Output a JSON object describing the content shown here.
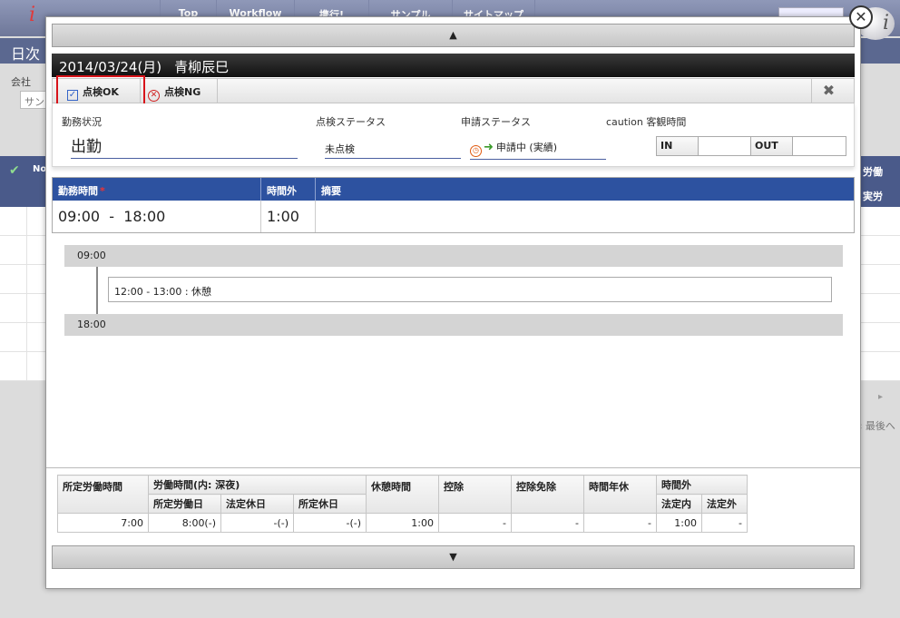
{
  "background": {
    "nav": [
      "Top",
      "Workflow",
      "携行!",
      "サンプル",
      "サイトマップ"
    ],
    "page_title": "日次",
    "company_label": "会社",
    "company_value": "サン",
    "table_no": "No",
    "right_col_1": "労働",
    "right_col_2": "実労",
    "last_link": "最後へ"
  },
  "modal": {
    "scroll_up": "▲",
    "scroll_down": "▼",
    "date": "2014/03/24(月)",
    "person": "青柳辰巳",
    "toolbar": {
      "ok_label": "点検OK",
      "ng_label": "点検NG",
      "close_icon": "✖"
    },
    "status": {
      "work_label": "勤務状況",
      "work_value": "出勤",
      "check_label": "点検ステータス",
      "check_value": "未点検",
      "app_label": "申請ステータス",
      "app_value": "申請中 (実績)",
      "caution_label": "caution 客観時間",
      "in_label": "IN",
      "out_label": "OUT"
    },
    "work_table": {
      "headers": [
        "勤務時間",
        "時間外",
        "摘要"
      ],
      "time_from": "09:00",
      "time_sep": "-",
      "time_to": "18:00",
      "overtime": "1:00",
      "memo": ""
    },
    "timeline": {
      "start": "09:00",
      "break": "12:00 - 13:00 : 休憩",
      "end": "18:00"
    },
    "summary": {
      "h_scheduled": "所定労働時間",
      "h_labor": "労働時間(内: 深夜)",
      "h_rest": "休憩時間",
      "h_deduct": "控除",
      "h_deduct_exempt": "控除免除",
      "h_hourly_leave": "時間年休",
      "h_overtime": "時間外",
      "sub_scheduled_day": "所定労働日",
      "sub_legal_holiday": "法定休日",
      "sub_scheduled_holiday": "所定休日",
      "sub_legal_in": "法定内",
      "sub_legal_out": "法定外",
      "values": [
        "7:00",
        "8:00(-)",
        "-(-)",
        "-(-)",
        "1:00",
        "-",
        "-",
        "-",
        "1:00",
        "-"
      ]
    }
  }
}
